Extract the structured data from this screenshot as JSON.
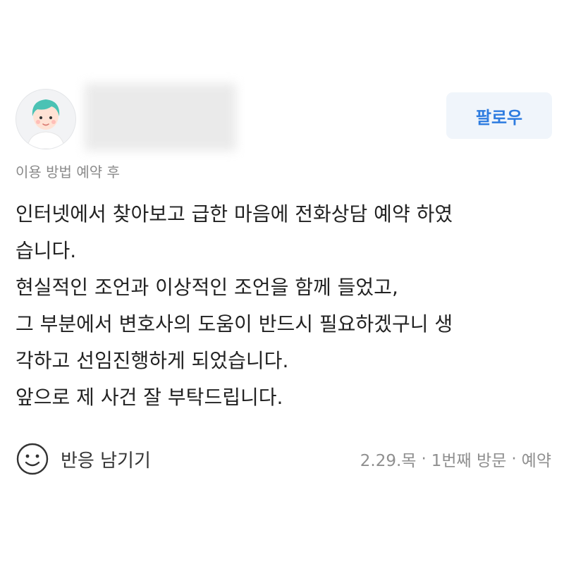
{
  "review": {
    "author": {
      "avatar_icon": "user-avatar-icon",
      "name_hidden": true
    },
    "follow_label": "팔로우",
    "visit_tags": "이용 방법 예약 후",
    "text_lines": [
      "인터넷에서 찾아보고 급한 마음에 전화상담 예약 하였",
      "습니다.",
      "현실적인 조언과 이상적인 조언을 함께 들었고,",
      "그 부분에서 변호사의 도움이 반드시 필요하겠구니 생",
      "각하고 선임진행하게 되었습니다.",
      "앞으로 제 사건 잘 부탁드립니다."
    ],
    "reaction_label": "반응 남기기",
    "reaction_icon": "smile-icon",
    "meta": {
      "date": "2.29.목",
      "visit_count": "1번째 방문",
      "method": "예약",
      "separator": "·"
    },
    "colors": {
      "accent": "#2e7ce0",
      "follow_bg": "#f0f5fb",
      "muted_text": "#8a8a8a",
      "body_text": "#222222"
    }
  }
}
